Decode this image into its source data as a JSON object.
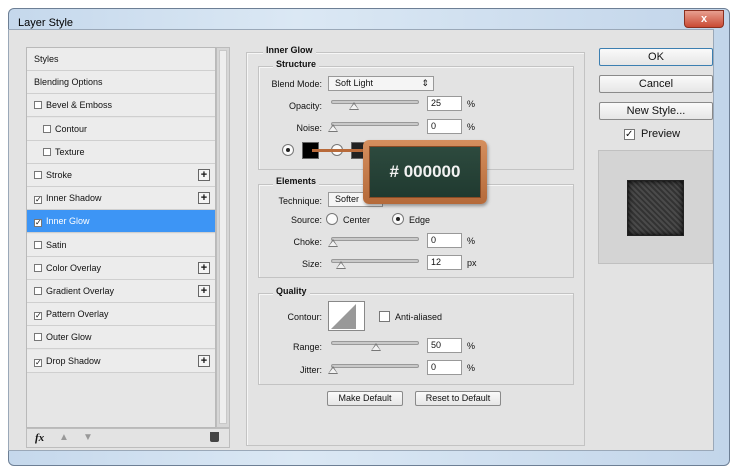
{
  "window": {
    "title": "Layer Style",
    "close": "x"
  },
  "sidebar": {
    "items": [
      {
        "label": "Styles",
        "check": null,
        "plus": false
      },
      {
        "label": "Blending Options",
        "check": null,
        "plus": false
      },
      {
        "label": "Bevel & Emboss",
        "check": false,
        "plus": false
      },
      {
        "label": "Contour",
        "check": false,
        "plus": false,
        "indent": true
      },
      {
        "label": "Texture",
        "check": false,
        "plus": false,
        "indent": true
      },
      {
        "label": "Stroke",
        "check": false,
        "plus": true
      },
      {
        "label": "Inner Shadow",
        "check": true,
        "plus": true
      },
      {
        "label": "Inner Glow",
        "check": true,
        "plus": false,
        "selected": true
      },
      {
        "label": "Satin",
        "check": false,
        "plus": false
      },
      {
        "label": "Color Overlay",
        "check": false,
        "plus": true
      },
      {
        "label": "Gradient Overlay",
        "check": false,
        "plus": true
      },
      {
        "label": "Pattern Overlay",
        "check": true,
        "plus": false
      },
      {
        "label": "Outer Glow",
        "check": false,
        "plus": false
      },
      {
        "label": "Drop Shadow",
        "check": true,
        "plus": true
      }
    ],
    "fx": "fx"
  },
  "panel": {
    "title": "Inner Glow",
    "structure": {
      "title": "Structure",
      "blend_label": "Blend Mode:",
      "blend_value": "Soft Light",
      "opacity_label": "Opacity:",
      "opacity": "25",
      "opacity_unit": "%",
      "noise_label": "Noise:",
      "noise": "0",
      "noise_unit": "%"
    },
    "elements": {
      "title": "Elements",
      "technique_label": "Technique:",
      "technique": "Softer",
      "source_label": "Source:",
      "center": "Center",
      "edge": "Edge",
      "choke_label": "Choke:",
      "choke": "0",
      "choke_unit": "%",
      "size_label": "Size:",
      "size": "12",
      "size_unit": "px"
    },
    "quality": {
      "title": "Quality",
      "contour_label": "Contour:",
      "anti": "Anti-aliased",
      "range_label": "Range:",
      "range": "50",
      "range_unit": "%",
      "jitter_label": "Jitter:",
      "jitter": "0",
      "jitter_unit": "%"
    },
    "make_default": "Make Default",
    "reset_default": "Reset to Default"
  },
  "callout": {
    "text": "# 000000",
    "color": "#000000"
  },
  "actions": {
    "ok": "OK",
    "cancel": "Cancel",
    "new_style": "New Style...",
    "preview": "Preview"
  }
}
